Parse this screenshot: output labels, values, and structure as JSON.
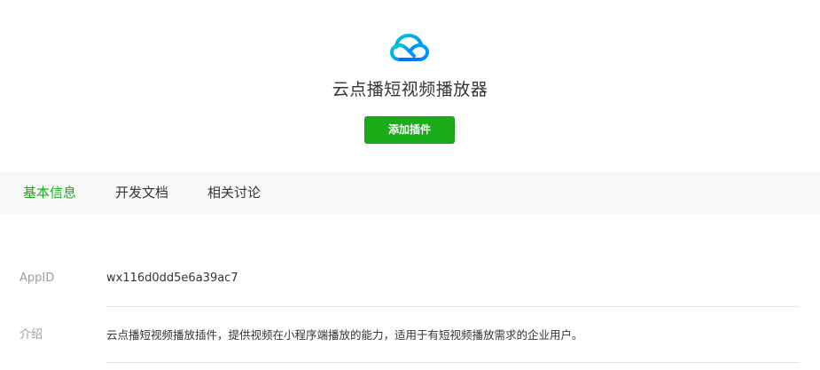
{
  "header": {
    "logo_icon": "cloud-icon",
    "logo_colors": [
      "#00a3ff",
      "#00c8dc",
      "#006eff"
    ],
    "title": "云点播短视频播放器",
    "add_button_label": "添加插件",
    "accent_color": "#1aad19"
  },
  "tabs": [
    {
      "label": "基本信息",
      "active": true
    },
    {
      "label": "开发文档",
      "active": false
    },
    {
      "label": "相关讨论",
      "active": false
    }
  ],
  "info": {
    "appid": {
      "label": "AppID",
      "value": "wx116d0dd5e6a39ac7"
    },
    "intro": {
      "label": "介绍",
      "value": "云点播短视频播放插件，提供视频在小程序端播放的能力，适用于有短视频播放需求的企业用户。"
    }
  }
}
